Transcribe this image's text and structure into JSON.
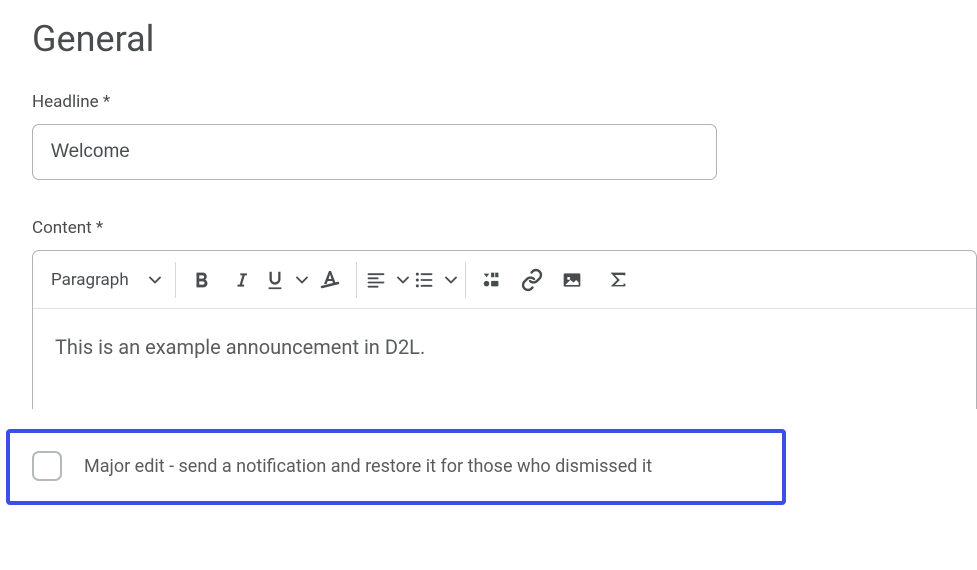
{
  "section": {
    "title": "General"
  },
  "headline": {
    "label": "Headline *",
    "value": "Welcome"
  },
  "content": {
    "label": "Content *",
    "body": "This is an example announcement in D2L."
  },
  "toolbar": {
    "format_label": "Paragraph"
  },
  "major_edit": {
    "label": "Major edit - send a notification and restore it for those who dismissed it",
    "checked": false
  }
}
